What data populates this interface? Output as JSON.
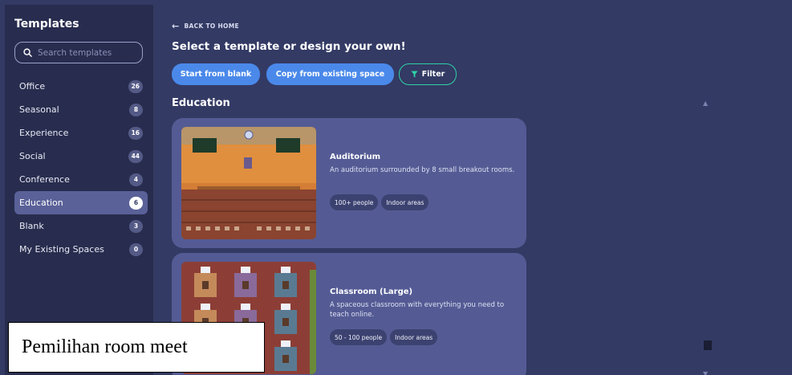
{
  "sidebar": {
    "title": "Templates",
    "search_placeholder": "Search templates",
    "items": [
      {
        "label": "Office",
        "count": "26"
      },
      {
        "label": "Seasonal",
        "count": "8"
      },
      {
        "label": "Experience",
        "count": "16"
      },
      {
        "label": "Social",
        "count": "44"
      },
      {
        "label": "Conference",
        "count": "4"
      },
      {
        "label": "Education",
        "count": "6"
      },
      {
        "label": "Blank",
        "count": "3"
      },
      {
        "label": "My Existing Spaces",
        "count": "0"
      }
    ],
    "active_item": "Education"
  },
  "main": {
    "back_label": "BACK TO HOME",
    "heading": "Select a template or design your own!",
    "buttons": {
      "start_blank": "Start from blank",
      "copy_existing": "Copy from existing space",
      "filter": "Filter"
    },
    "section_title": "Education",
    "cards": [
      {
        "title": "Auditorium",
        "description": "An auditorium surrounded by 8 small breakout rooms.",
        "tags": [
          "100+ people",
          "Indoor areas"
        ]
      },
      {
        "title": "Classroom (Large)",
        "description": "A spaceous classroom with everything you need to teach online.",
        "tags": [
          "50 - 100 people",
          "Indoor areas"
        ]
      }
    ]
  },
  "caption": "Pemilihan room meet",
  "colors": {
    "background": "#333a64",
    "sidebar": "#282d4f",
    "card": "#545b94",
    "primary_button": "#4a89ea",
    "filter_border": "#2fd3a5"
  }
}
